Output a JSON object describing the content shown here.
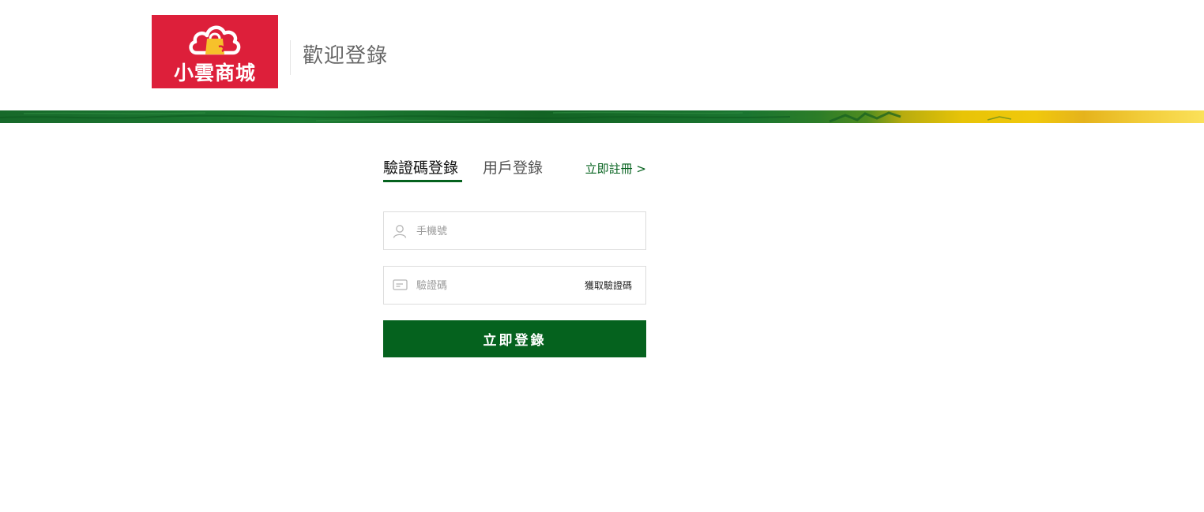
{
  "header": {
    "logo_text": "小雲商城",
    "welcome": "歡迎登錄"
  },
  "tabs": [
    {
      "label": "驗證碼登錄",
      "active": true
    },
    {
      "label": "用戶登錄",
      "active": false
    }
  ],
  "register_link": "立即註冊 >",
  "phone_field": {
    "placeholder": "手機號",
    "value": "",
    "icon": "user-icon"
  },
  "code_field": {
    "placeholder": "驗證碼",
    "value": "",
    "icon": "message-icon"
  },
  "get_code_label": "獲取驗證碼",
  "login_button": "立即登錄",
  "colors": {
    "brand_red": "#dd1f3a",
    "accent_green": "#05621e",
    "logo_bag": "#f6c12b"
  }
}
